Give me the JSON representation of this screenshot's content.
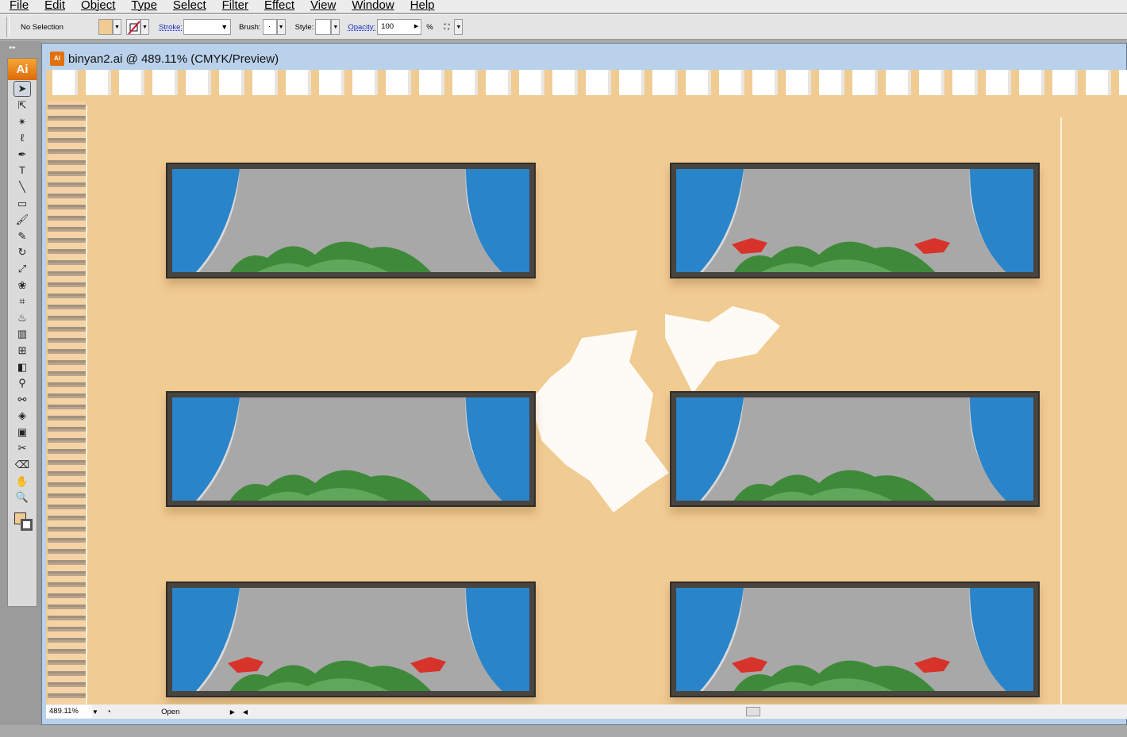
{
  "menu": [
    "File",
    "Edit",
    "Object",
    "Type",
    "Select",
    "Filter",
    "Effect",
    "View",
    "Window",
    "Help"
  ],
  "control": {
    "selection": "No Selection",
    "fill_color": "#f0cb92",
    "stroke_label": "Stroke:",
    "brush_label": "Brush:",
    "brush_value": "·",
    "style_label": "Style:",
    "opacity_label": "Opacity:",
    "opacity_value": "100",
    "percent": "%"
  },
  "document": {
    "title": "binyan2.ai @ 489.11% (CMYK/Preview)",
    "file_icon": "AI"
  },
  "toolbox": {
    "logo": "Ai",
    "tools": [
      {
        "name": "selection-tool-icon",
        "glyph": "➤"
      },
      {
        "name": "direct-selection-tool-icon",
        "glyph": "⇱"
      },
      {
        "name": "magic-wand-tool-icon",
        "glyph": "✴"
      },
      {
        "name": "lasso-tool-icon",
        "glyph": "ℓ"
      },
      {
        "name": "pen-tool-icon",
        "glyph": "✒"
      },
      {
        "name": "type-tool-icon",
        "glyph": "T"
      },
      {
        "name": "line-tool-icon",
        "glyph": "╲"
      },
      {
        "name": "rectangle-tool-icon",
        "glyph": "▭"
      },
      {
        "name": "paintbrush-tool-icon",
        "glyph": "🖌"
      },
      {
        "name": "pencil-tool-icon",
        "glyph": "✎"
      },
      {
        "name": "rotate-tool-icon",
        "glyph": "↻"
      },
      {
        "name": "scale-tool-icon",
        "glyph": "⤢"
      },
      {
        "name": "warp-tool-icon",
        "glyph": "❀"
      },
      {
        "name": "free-transform-tool-icon",
        "glyph": "⌗"
      },
      {
        "name": "symbol-sprayer-tool-icon",
        "glyph": "♨"
      },
      {
        "name": "graph-tool-icon",
        "glyph": "▥"
      },
      {
        "name": "mesh-tool-icon",
        "glyph": "⊞"
      },
      {
        "name": "gradient-tool-icon",
        "glyph": "◧"
      },
      {
        "name": "eyedropper-tool-icon",
        "glyph": "⚲"
      },
      {
        "name": "blend-tool-icon",
        "glyph": "⚯"
      },
      {
        "name": "live-paint-tool-icon",
        "glyph": "◈"
      },
      {
        "name": "live-paint-selection-icon",
        "glyph": "▣"
      },
      {
        "name": "slice-tool-icon",
        "glyph": "✂"
      },
      {
        "name": "eraser-tool-icon",
        "glyph": "⌫"
      },
      {
        "name": "hand-tool-icon",
        "glyph": "✋"
      },
      {
        "name": "zoom-tool-icon",
        "glyph": "🔍"
      }
    ]
  },
  "statusbar": {
    "zoom": "489.11%",
    "status": "Open"
  },
  "colors": {
    "wall": "#f0cb92",
    "curtain": "#2a84c9",
    "glass": "#a8a8a8",
    "frame": "#48443f"
  },
  "windows": [
    {
      "flowers": false
    },
    {
      "flowers": true
    },
    {
      "flowers": false
    },
    {
      "flowers": false
    },
    {
      "flowers": true
    },
    {
      "flowers": true
    }
  ]
}
